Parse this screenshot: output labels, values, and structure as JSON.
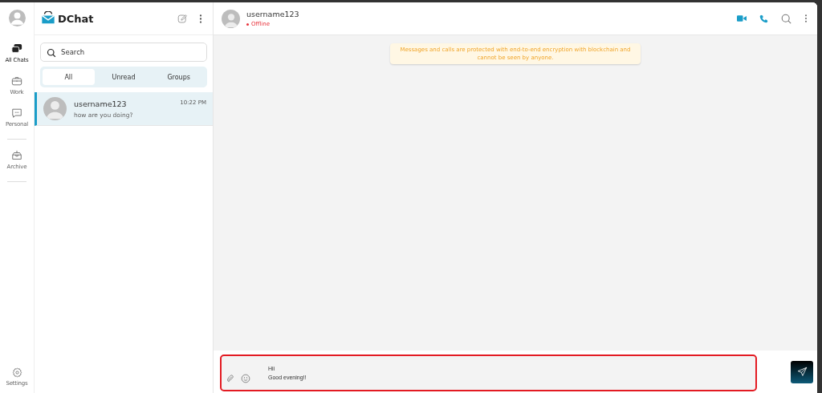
{
  "rail": {
    "items": [
      {
        "label": "All Chats",
        "kind": "chats",
        "selected": true
      },
      {
        "label": "Work",
        "kind": "work",
        "selected": false
      },
      {
        "label": "Personal",
        "kind": "personal",
        "selected": false
      },
      {
        "label": "Archive",
        "kind": "archive",
        "selected": false
      }
    ],
    "settings": "Settings"
  },
  "sidebar": {
    "brand": "DChat",
    "search": {
      "placeholder": "Search"
    },
    "tabs": [
      {
        "label": "All",
        "selected": true
      },
      {
        "label": "Unread",
        "selected": false
      },
      {
        "label": "Groups",
        "selected": false
      }
    ],
    "chats": [
      {
        "name": "username123",
        "time": "10:22 PM",
        "preview": "how are you doing?",
        "selected": true
      }
    ]
  },
  "header": {
    "name": "username123",
    "status": "Offline",
    "online": false
  },
  "notice": "Messages and calls are protected with end-to-end encryption with blockchain and cannot be seen by anyone.",
  "composer": {
    "value": "Hii\nGood evening!!",
    "highlighted": true
  }
}
